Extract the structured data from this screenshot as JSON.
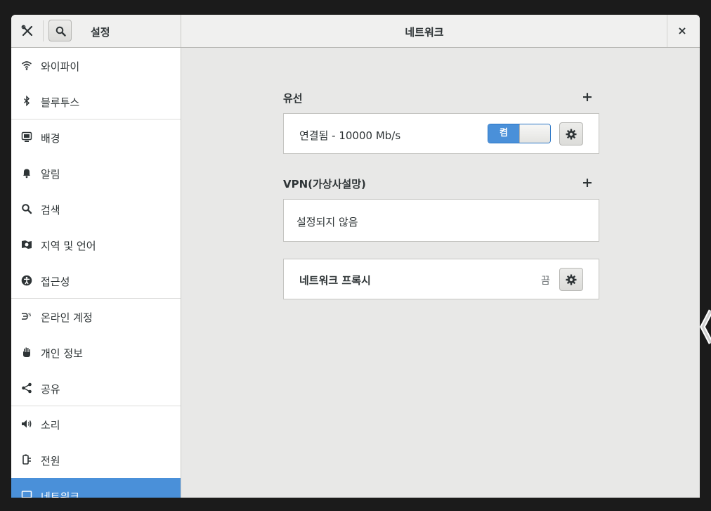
{
  "header": {
    "left_title": "설정",
    "title": "네트워크",
    "close_label": "×"
  },
  "sidebar": {
    "items": [
      {
        "label": "와이파이",
        "icon": "wifi-icon"
      },
      {
        "label": "블루투스",
        "icon": "bluetooth-icon"
      },
      {
        "label": "배경",
        "icon": "background-icon"
      },
      {
        "label": "알림",
        "icon": "bell-icon"
      },
      {
        "label": "검색",
        "icon": "search-icon"
      },
      {
        "label": "지역 및 언어",
        "icon": "region-icon"
      },
      {
        "label": "접근성",
        "icon": "accessibility-icon"
      },
      {
        "label": "온라인 계정",
        "icon": "online-accounts-icon"
      },
      {
        "label": "개인 정보",
        "icon": "privacy-hand-icon"
      },
      {
        "label": "공유",
        "icon": "share-icon"
      },
      {
        "label": "소리",
        "icon": "speaker-icon"
      },
      {
        "label": "전원",
        "icon": "power-plug-icon"
      },
      {
        "label": "네트워크",
        "icon": "network-icon"
      }
    ]
  },
  "wired": {
    "title": "유선",
    "add_label": "+",
    "status": "연결됨 - 10000 Mb/s",
    "toggle_label": "켬"
  },
  "vpn": {
    "title": "VPN(가상사설망)",
    "add_label": "+",
    "empty_text": "설정되지 않음"
  },
  "proxy": {
    "title": "네트워크 프록시",
    "status": "끔"
  },
  "colors": {
    "accent": "#4a90d9",
    "window_bg": "#e8e8e7",
    "sidebar_bg": "#ffffff"
  }
}
